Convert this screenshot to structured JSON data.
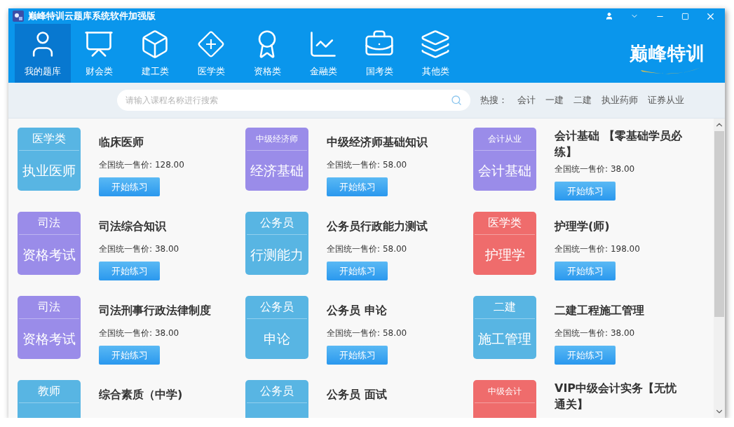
{
  "window": {
    "title": "巅峰特训云题库系统软件加强版"
  },
  "nav": [
    {
      "label": "我的题库",
      "selected": true
    },
    {
      "label": "财会类",
      "selected": false
    },
    {
      "label": "建工类",
      "selected": false
    },
    {
      "label": "医学类",
      "selected": false
    },
    {
      "label": "资格类",
      "selected": false
    },
    {
      "label": "金融类",
      "selected": false
    },
    {
      "label": "国考类",
      "selected": false
    },
    {
      "label": "其他类",
      "selected": false
    }
  ],
  "brand": "巅峰特训",
  "search": {
    "placeholder": "请输入课程名称进行搜索",
    "hot_label": "热搜：",
    "hot": [
      "会计",
      "一建",
      "二建",
      "执业药师",
      "证券从业"
    ]
  },
  "courses": [
    {
      "category": "医学类",
      "subject": "执业医师",
      "color": "#58b5e3",
      "title": "临床医师",
      "price_label": "全国统一售价:",
      "price": "128.00",
      "button": "开始练习"
    },
    {
      "category": "中级经济师",
      "subject": "经济基础",
      "color": "#9a8ce9",
      "title": "中级经济师基础知识",
      "price_label": "全国统一售价:",
      "price": "58.00",
      "button": "开始练习"
    },
    {
      "category": "会计从业",
      "subject": "会计基础",
      "color": "#9a8ce9",
      "title": "会计基础 【零基础学员必练】",
      "price_label": "全国统一售价:",
      "price": "38.00",
      "button": "开始练习"
    },
    {
      "category": "司法",
      "subject": "资格考试",
      "color": "#9a8ce9",
      "title": "司法综合知识",
      "price_label": "全国统一售价:",
      "price": "38.00",
      "button": "开始练习"
    },
    {
      "category": "公务员",
      "subject": "行测能力",
      "color": "#58b5e3",
      "title": "公务员行政能力测试",
      "price_label": "全国统一售价:",
      "price": "58.00",
      "button": "开始练习"
    },
    {
      "category": "医学类",
      "subject": "护理学",
      "color": "#ef6c6c",
      "title": "护理学(师)",
      "price_label": "全国统一售价:",
      "price": "198.00",
      "button": "开始练习"
    },
    {
      "category": "司法",
      "subject": "资格考试",
      "color": "#9a8ce9",
      "title": "司法刑事行政法律制度",
      "price_label": "全国统一售价:",
      "price": "38.00",
      "button": "开始练习"
    },
    {
      "category": "公务员",
      "subject": "申论",
      "color": "#58b5e3",
      "title": "公务员  申论",
      "price_label": "全国统一售价:",
      "price": "58.00",
      "button": "开始练习"
    },
    {
      "category": "二建",
      "subject": "施工管理",
      "color": "#58b5e3",
      "title": "二建工程施工管理",
      "price_label": "全国统一售价:",
      "price": "38.00",
      "button": "开始练习"
    },
    {
      "category": "教师",
      "color": "#58b5e3",
      "title": "综合素质（中学)"
    },
    {
      "category": "公务员",
      "color": "#58b5e3",
      "title": "公务员  面试"
    },
    {
      "category": "中级会计",
      "color": "#ef6c6c",
      "title": "VIP中级会计实务【无忧通关】"
    }
  ]
}
